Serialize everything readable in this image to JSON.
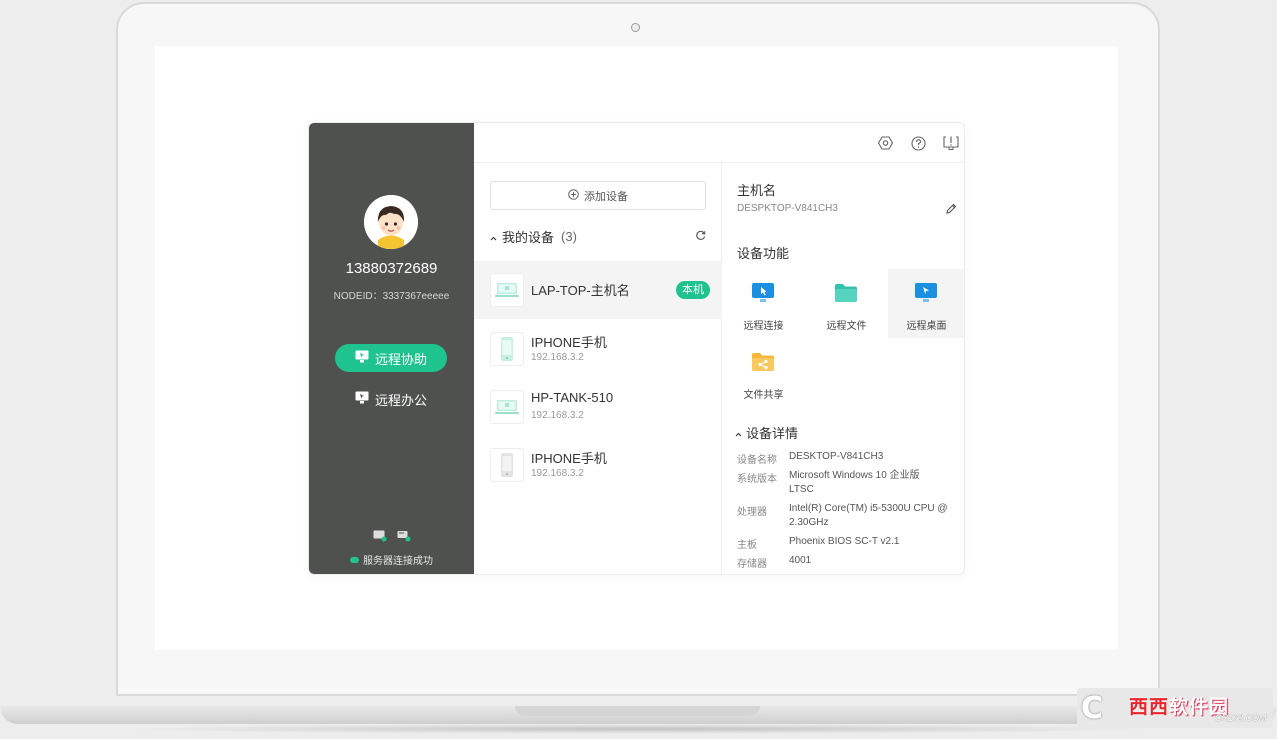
{
  "sidebar": {
    "phone": "13880372689",
    "nodeid": "NODEID：3337367eeeee",
    "assist_label": "远程协助",
    "office_label": "远程办公",
    "server_status": "服务器连接成功"
  },
  "devices": {
    "add_label": "添加设备",
    "section_label": "我的设备",
    "section_count": "(3)",
    "items": [
      {
        "name": "LAP-TOP-主机名",
        "ip": "",
        "badge": "本机"
      },
      {
        "name": "IPHONE手机",
        "ip": "192.168.3.2"
      },
      {
        "name": "HP-TANK-510",
        "ip": "192.168.3.2"
      },
      {
        "name": "IPHONE手机",
        "ip": "192.168.3.2"
      }
    ]
  },
  "detail": {
    "host_title": "主机名",
    "host_value": "DESPKTOP-V841CH3",
    "functions_title": "设备功能",
    "functions": [
      "远程连接",
      "远程文件",
      "远程桌面",
      "文件共享"
    ],
    "details_title": "设备详情",
    "details": [
      {
        "k": "设备名称",
        "v": "DESKTOP-V841CH3"
      },
      {
        "k": "系统版本",
        "v": "Microsoft Windows 10 企业版 LTSC"
      },
      {
        "k": "处理器",
        "v": "Intel(R) Core(TM) i5-5300U CPU @ 2.30GHz"
      },
      {
        "k": "主板",
        "v": "Phoenix BIOS SC-T v2.1"
      },
      {
        "k": "存储器",
        "v": "4001"
      }
    ]
  },
  "watermark": {
    "logo": "C",
    "text_red": "西西",
    "text": "软件园",
    "domain": "CR173.COM"
  },
  "colors": {
    "accent": "#1ec38e",
    "sidebar": "#4f514f",
    "function_blue": "#1b8fe0",
    "function_teal": "#33c2b0",
    "function_orange": "#f5b73b"
  }
}
